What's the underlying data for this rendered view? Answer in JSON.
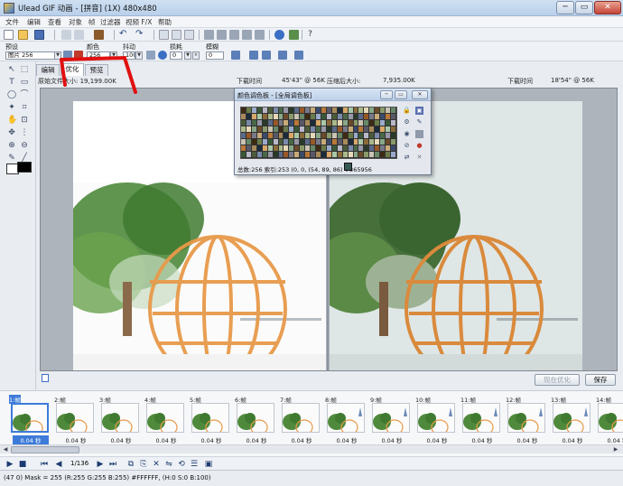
{
  "window": {
    "title": "Ulead GIF 动画 - [拼音] (1X) 480x480",
    "buttons": [
      "─",
      "▭",
      "✕"
    ]
  },
  "menu": [
    "文件",
    "编辑",
    "查看",
    "对象",
    "帧",
    "过滤器",
    "视频 F/X",
    "帮助"
  ],
  "props": {
    "preset_label": "预设",
    "preset_value": "图片 256",
    "color_label": "颜色",
    "color_value": "256",
    "dither_label": "抖动",
    "dither_value": "100",
    "lossy_label": "损耗",
    "lossy_value": "0",
    "blur_label": "模糊",
    "blur_value": "0"
  },
  "tabs": [
    "编辑",
    "优化",
    "预览"
  ],
  "info": {
    "original_size": "原始文件大小: 19,199.00K",
    "download_time_left": "下载时间",
    "time_left_value": "45'43\" @ 56K",
    "compressed_size": "压缩后大小:",
    "compressed_value": "7,935.00K",
    "download_time_right": "下载时间",
    "time_right_value": "18'54\" @ 56K"
  },
  "palette": {
    "title": "颜色调色板 - [全局调色板]",
    "status": "总数:256 索引:253 (0, 0,    (54, 89, 86) #365956"
  },
  "buttons": {
    "optimize_now": "现在优化",
    "save": "保存"
  },
  "frames": [
    {
      "label": "1:帧",
      "time": "0.04 秒"
    },
    {
      "label": "2:帧",
      "time": "0.04 秒"
    },
    {
      "label": "3:帧",
      "time": "0.04 秒"
    },
    {
      "label": "4:帧",
      "time": "0.04 秒"
    },
    {
      "label": "5:帧",
      "time": "0.04 秒"
    },
    {
      "label": "6:帧",
      "time": "0.04 秒"
    },
    {
      "label": "7:帧",
      "time": "0.04 秒"
    },
    {
      "label": "8:帧",
      "time": "0.04 秒"
    },
    {
      "label": "9:帧",
      "time": "0.04 秒"
    },
    {
      "label": "10:帧",
      "time": "0.04 秒"
    },
    {
      "label": "11:帧",
      "time": "0.04 秒"
    },
    {
      "label": "12:帧",
      "time": "0.04 秒"
    },
    {
      "label": "13:帧",
      "time": "0.04 秒"
    },
    {
      "label": "14:帧",
      "time": "0.04 秒"
    }
  ],
  "playbar": {
    "frame_counter": "1/136"
  },
  "status": "(47 0) Mask = 255 (R:255 G:255 B:255) #FFFFFF, (H:0 S:0 B:100)",
  "colors": {
    "accent": "#3d7bd9",
    "annotation_red": "#e01010",
    "titlebar": "#bfd3ea"
  }
}
